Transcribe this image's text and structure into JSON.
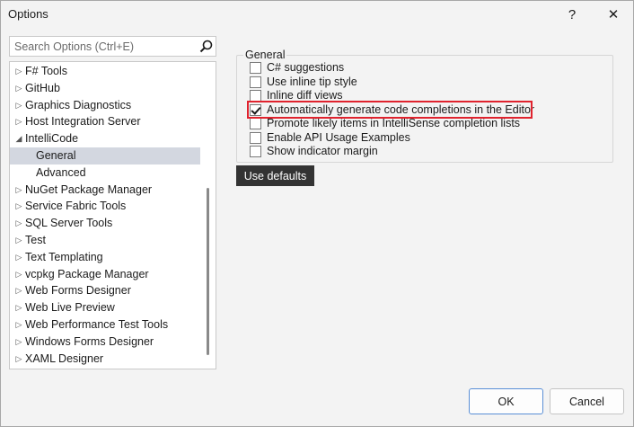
{
  "window": {
    "title": "Options",
    "help_glyph": "?",
    "close_glyph": "✕"
  },
  "search": {
    "placeholder": "Search Options (Ctrl+E)",
    "icon": "search-icon"
  },
  "tree": {
    "items": [
      {
        "label": "F# Tools",
        "expander": "▷"
      },
      {
        "label": "GitHub",
        "expander": "▷"
      },
      {
        "label": "Graphics Diagnostics",
        "expander": "▷"
      },
      {
        "label": "Host Integration Server",
        "expander": "▷"
      },
      {
        "label": "IntelliCode",
        "expander": "◢"
      },
      {
        "label": "General",
        "expander": "",
        "selected": true
      },
      {
        "label": "Advanced",
        "expander": ""
      },
      {
        "label": "NuGet Package Manager",
        "expander": "▷"
      },
      {
        "label": "Service Fabric Tools",
        "expander": "▷"
      },
      {
        "label": "SQL Server Tools",
        "expander": "▷"
      },
      {
        "label": "Test",
        "expander": "▷"
      },
      {
        "label": "Text Templating",
        "expander": "▷"
      },
      {
        "label": "vcpkg Package Manager",
        "expander": "▷"
      },
      {
        "label": "Web Forms Designer",
        "expander": "▷"
      },
      {
        "label": "Web Live Preview",
        "expander": "▷"
      },
      {
        "label": "Web Performance Test Tools",
        "expander": "▷"
      },
      {
        "label": "Windows Forms Designer",
        "expander": "▷"
      },
      {
        "label": "XAML Designer",
        "expander": "▷"
      }
    ]
  },
  "general": {
    "group_title": "General",
    "options": [
      {
        "label": "C# suggestions",
        "checked": false
      },
      {
        "label": "Use inline tip style",
        "checked": false
      },
      {
        "label": "Inline diff views",
        "checked": false
      },
      {
        "label": "Automatically generate code completions in the Editor",
        "checked": true,
        "highlighted": true
      },
      {
        "label": "Promote likely items in IntelliSense completion lists",
        "checked": false
      },
      {
        "label": "Enable API Usage Examples",
        "checked": false
      },
      {
        "label": "Show indicator margin",
        "checked": false
      }
    ],
    "use_defaults_label": "Use defaults"
  },
  "footer": {
    "ok_label": "OK",
    "cancel_label": "Cancel"
  },
  "colors": {
    "window_bg": "#f3f3f3",
    "selected_bg": "#d3d7e0",
    "highlight_border": "#e0232e",
    "default_button_bg": "#333333",
    "ok_border": "#5a8fd6"
  }
}
